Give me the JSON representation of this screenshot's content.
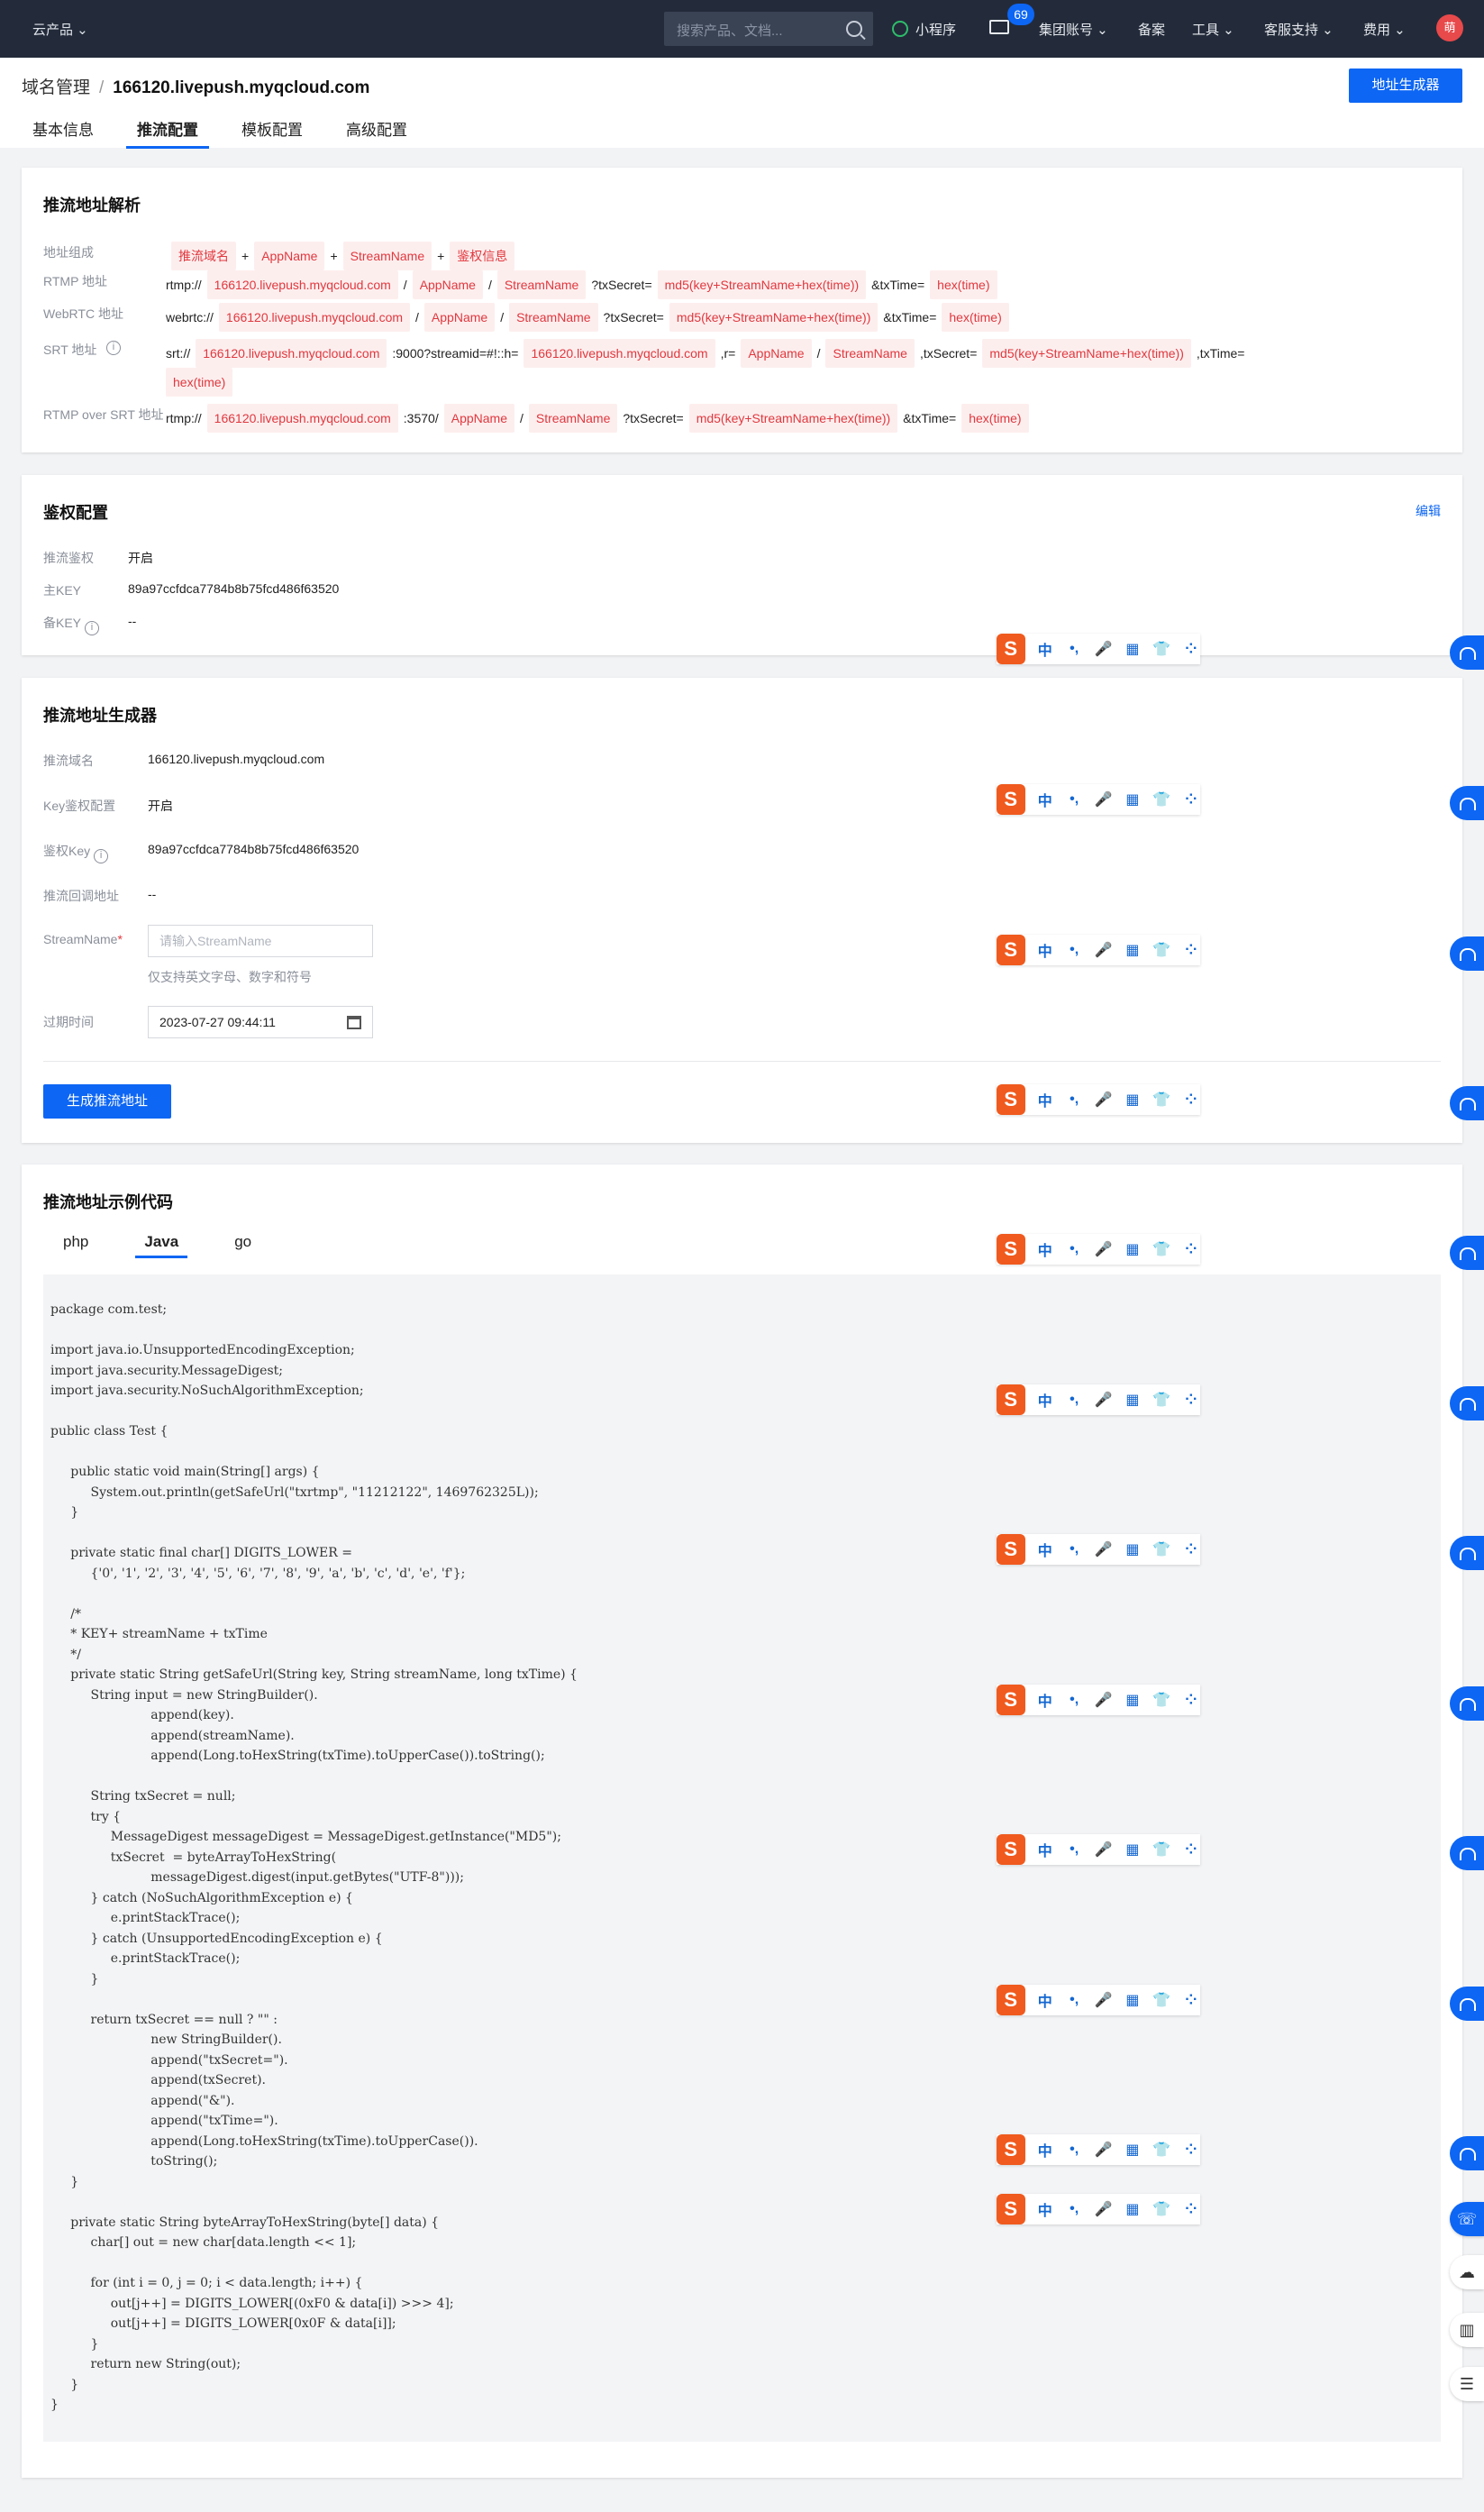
{
  "topnav": {
    "product": "云产品 ⌄",
    "search_placeholder": "搜索产品、文档...",
    "mini_program": "小程序",
    "mail_badge": "69",
    "group_account": "集团账号 ⌄",
    "filing": "备案",
    "tools": "工具 ⌄",
    "support": "客服支持 ⌄",
    "billing": "费用 ⌄",
    "avatar_text": "萌"
  },
  "header": {
    "breadcrumb_parent": "域名管理",
    "breadcrumb_sep": "/",
    "breadcrumb_current": "166120.livepush.myqcloud.com",
    "generator_button": "地址生成器",
    "tabs": [
      "基本信息",
      "推流配置",
      "模板配置",
      "高级配置"
    ]
  },
  "parse_card": {
    "title": "推流地址解析",
    "rows": [
      {
        "label": "地址组成",
        "parts": [
          {
            "t": "tag",
            "v": "推流域名"
          },
          {
            "t": "plain",
            "v": "+"
          },
          {
            "t": "tag",
            "v": "AppName"
          },
          {
            "t": "plain",
            "v": "+"
          },
          {
            "t": "tag",
            "v": "StreamName"
          },
          {
            "t": "plain",
            "v": "+"
          },
          {
            "t": "tag",
            "v": "鉴权信息"
          }
        ]
      },
      {
        "label": "RTMP 地址",
        "parts": [
          {
            "t": "plain",
            "v": "rtmp://"
          },
          {
            "t": "tag",
            "v": "166120.livepush.myqcloud.com"
          },
          {
            "t": "plain",
            "v": "/"
          },
          {
            "t": "tag",
            "v": "AppName"
          },
          {
            "t": "plain",
            "v": "/"
          },
          {
            "t": "tag",
            "v": "StreamName"
          },
          {
            "t": "plain",
            "v": "?txSecret="
          },
          {
            "t": "tag",
            "v": "md5(key+StreamName+hex(time))"
          },
          {
            "t": "plain",
            "v": "&txTime="
          },
          {
            "t": "tag",
            "v": "hex(time)"
          }
        ]
      },
      {
        "label": "WebRTC 地址",
        "parts": [
          {
            "t": "plain",
            "v": "webrtc://"
          },
          {
            "t": "tag",
            "v": "166120.livepush.myqcloud.com"
          },
          {
            "t": "plain",
            "v": "/"
          },
          {
            "t": "tag",
            "v": "AppName"
          },
          {
            "t": "plain",
            "v": "/"
          },
          {
            "t": "tag",
            "v": "StreamName"
          },
          {
            "t": "plain",
            "v": "?txSecret="
          },
          {
            "t": "tag",
            "v": "md5(key+StreamName+hex(time))"
          },
          {
            "t": "plain",
            "v": "&txTime="
          },
          {
            "t": "tag",
            "v": "hex(time)"
          }
        ]
      },
      {
        "label": "SRT 地址",
        "parts": [
          {
            "t": "plain",
            "v": "srt://"
          },
          {
            "t": "tag",
            "v": "166120.livepush.myqcloud.com"
          },
          {
            "t": "plain",
            "v": ":9000?streamid=#!::h="
          },
          {
            "t": "tag",
            "v": "166120.livepush.myqcloud.com"
          },
          {
            "t": "plain",
            "v": ",r="
          },
          {
            "t": "tag",
            "v": "AppName"
          },
          {
            "t": "plain",
            "v": "/"
          },
          {
            "t": "tag",
            "v": "StreamName"
          },
          {
            "t": "plain",
            "v": ",txSecret="
          },
          {
            "t": "tag",
            "v": "md5(key+StreamName+hex(time))"
          },
          {
            "t": "plain",
            "v": ",txTime="
          }
        ],
        "wrap": "hex(time)"
      },
      {
        "label": "RTMP over SRT 地址",
        "parts": [
          {
            "t": "plain",
            "v": "rtmp://"
          },
          {
            "t": "tag",
            "v": "166120.livepush.myqcloud.com"
          },
          {
            "t": "plain",
            "v": ":3570/"
          },
          {
            "t": "tag",
            "v": "AppName"
          },
          {
            "t": "plain",
            "v": "/"
          },
          {
            "t": "tag",
            "v": "StreamName"
          },
          {
            "t": "plain",
            "v": "?txSecret="
          },
          {
            "t": "tag",
            "v": "md5(key+StreamName+hex(time))"
          },
          {
            "t": "plain",
            "v": "&txTime="
          },
          {
            "t": "tag",
            "v": "hex(time)"
          }
        ]
      }
    ]
  },
  "auth_card": {
    "title": "鉴权配置",
    "edit": "编辑",
    "push_auth_label": "推流鉴权",
    "push_auth_value": "开启",
    "main_key_label": "主KEY",
    "main_key_value": "89a97ccfdca7784b8b75fcd486f63520",
    "backup_key_label": "备KEY",
    "backup_key_value": "--"
  },
  "gen_card": {
    "title": "推流地址生成器",
    "domain_label": "推流域名",
    "domain_value": "166120.livepush.myqcloud.com",
    "key_auth_label": "Key鉴权配置",
    "key_auth_value": "开启",
    "auth_key_label": "鉴权Key",
    "auth_key_value": "89a97ccfdca7784b8b75fcd486f63520",
    "callback_label": "推流回调地址",
    "callback_value": "--",
    "stream_label": "StreamName",
    "stream_required": "*",
    "stream_placeholder": "请输入StreamName",
    "stream_hint": "仅支持英文字母、数字和符号",
    "expire_label": "过期时间",
    "expire_value": "2023-07-27 09:44:11",
    "generate_button": "生成推流地址"
  },
  "code_card": {
    "title": "推流地址示例代码",
    "tabs": [
      "php",
      "Java",
      "go"
    ],
    "active_tab": "Java",
    "code": "package com.test;\n\nimport java.io.UnsupportedEncodingException;\nimport java.security.MessageDigest;\nimport java.security.NoSuchAlgorithmException;\n\npublic class Test {\n\n     public static void main(String[] args) {\n          System.out.println(getSafeUrl(\"txrtmp\", \"11212122\", 1469762325L));\n     }\n\n     private static final char[] DIGITS_LOWER =\n          {'0', '1', '2', '3', '4', '5', '6', '7', '8', '9', 'a', 'b', 'c', 'd', 'e', 'f'};\n\n     /*\n     * KEY+ streamName + txTime\n     */\n     private static String getSafeUrl(String key, String streamName, long txTime) {\n          String input = new StringBuilder().\n                         append(key).\n                         append(streamName).\n                         append(Long.toHexString(txTime).toUpperCase()).toString();\n\n          String txSecret = null;\n          try {\n               MessageDigest messageDigest = MessageDigest.getInstance(\"MD5\");\n               txSecret  = byteArrayToHexString(\n                         messageDigest.digest(input.getBytes(\"UTF-8\")));\n          } catch (NoSuchAlgorithmException e) {\n               e.printStackTrace();\n          } catch (UnsupportedEncodingException e) {\n               e.printStackTrace();\n          }\n\n          return txSecret == null ? \"\" :\n                         new StringBuilder().\n                         append(\"txSecret=\").\n                         append(txSecret).\n                         append(\"&\").\n                         append(\"txTime=\").\n                         append(Long.toHexString(txTime).toUpperCase()).\n                         toString();\n     }\n\n     private static String byteArrayToHexString(byte[] data) {\n          char[] out = new char[data.length << 1];\n\n          for (int i = 0, j = 0; i < data.length; i++) {\n               out[j++] = DIGITS_LOWER[(0xF0 & data[i]) >>> 4];\n               out[j++] = DIGITS_LOWER[0x0F & data[i]];\n          }\n          return new String(out);\n     }\n}"
  },
  "ime": {
    "logo": "S",
    "glyphs": [
      "中",
      "•,",
      "🎤",
      "▦",
      "👕",
      "⁘"
    ]
  },
  "side_tools": {
    "support_icon": "headset-icon",
    "cloud_icon": "cloud-icon",
    "doc_icon": "book-icon",
    "list_icon": "list-icon"
  }
}
